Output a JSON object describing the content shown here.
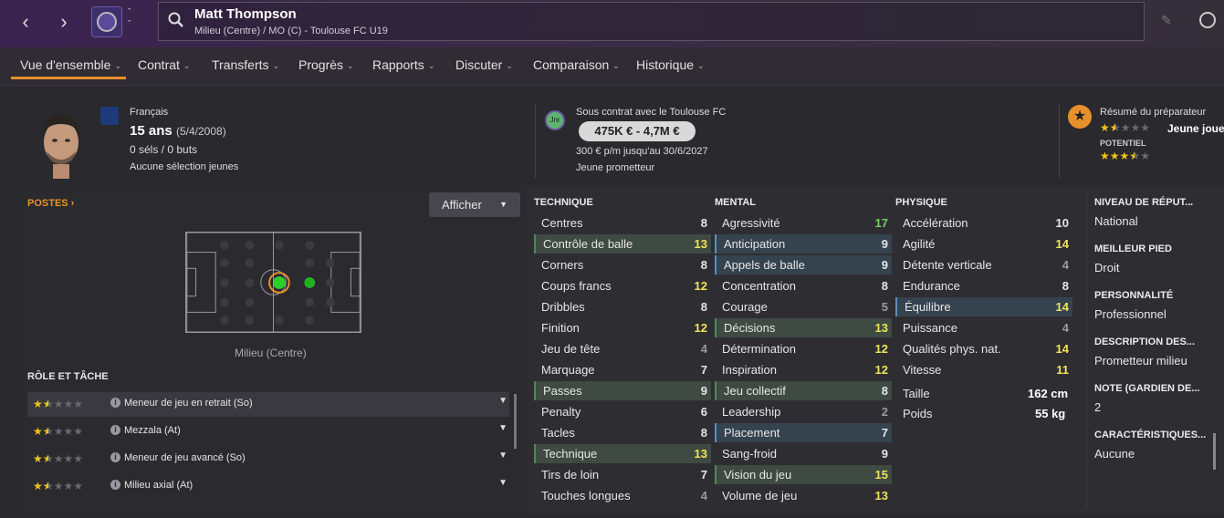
{
  "header": {
    "player_name": "Matt Thompson",
    "player_sub": "Milieu (Centre) / MO (C) - Toulouse FC U19"
  },
  "tabs": [
    {
      "label": "Vue d'ensemble"
    },
    {
      "label": "Contrat"
    },
    {
      "label": "Transferts"
    },
    {
      "label": "Progrès"
    },
    {
      "label": "Rapports"
    },
    {
      "label": "Discuter"
    },
    {
      "label": "Comparaison"
    },
    {
      "label": "Historique"
    }
  ],
  "profile": {
    "nationality": "Français",
    "age": "15 ans",
    "dob": "(5/4/2008)",
    "caps": "0 séls / 0 buts",
    "youth": "Aucune sélection jeunes"
  },
  "contract": {
    "badge": "Jnr",
    "club_line": "Sous contrat avec le Toulouse FC",
    "value_range": "475K € - 4,7M €",
    "wage_line": "300 € p/m jusqu'au 30/6/2027",
    "status": "Jeune prometteur"
  },
  "scout": {
    "title": "Résumé du préparateur",
    "current_stars": 1.5,
    "summary": "Jeune joue",
    "potential_label": "POTENTIEL",
    "potential_stars": 3.5
  },
  "positions": {
    "title": "POSTES",
    "show_button": "Afficher",
    "pitch_label": "Milieu (Centre)"
  },
  "roles": {
    "title": "RÔLE ET TÂCHE",
    "items": [
      {
        "label": "Meneur de jeu en retrait (So)",
        "stars": 1.5
      },
      {
        "label": "Mezzala (At)",
        "stars": 1.5
      },
      {
        "label": "Meneur de jeu avancé (So)",
        "stars": 1.5
      },
      {
        "label": "Milieu axial (At)",
        "stars": 1.5
      }
    ]
  },
  "technique": {
    "title": "TECHNIQUE",
    "attrs": [
      {
        "name": "Centres",
        "value": "8",
        "hl": ""
      },
      {
        "name": "Contrôle de balle",
        "value": "13",
        "hl": "g"
      },
      {
        "name": "Corners",
        "value": "8",
        "hl": ""
      },
      {
        "name": "Coups francs",
        "value": "12",
        "hl": ""
      },
      {
        "name": "Dribbles",
        "value": "8",
        "hl": ""
      },
      {
        "name": "Finition",
        "value": "12",
        "hl": ""
      },
      {
        "name": "Jeu de tête",
        "value": "4",
        "hl": ""
      },
      {
        "name": "Marquage",
        "value": "7",
        "hl": ""
      },
      {
        "name": "Passes",
        "value": "9",
        "hl": "g"
      },
      {
        "name": "Penalty",
        "value": "6",
        "hl": ""
      },
      {
        "name": "Tacles",
        "value": "8",
        "hl": ""
      },
      {
        "name": "Technique",
        "value": "13",
        "hl": "g"
      },
      {
        "name": "Tirs de loin",
        "value": "7",
        "hl": ""
      },
      {
        "name": "Touches longues",
        "value": "4",
        "hl": ""
      }
    ]
  },
  "mental": {
    "title": "MENTAL",
    "attrs": [
      {
        "name": "Agressivité",
        "value": "17",
        "hl": ""
      },
      {
        "name": "Anticipation",
        "value": "9",
        "hl": "b"
      },
      {
        "name": "Appels de balle",
        "value": "9",
        "hl": "b"
      },
      {
        "name": "Concentration",
        "value": "8",
        "hl": ""
      },
      {
        "name": "Courage",
        "value": "5",
        "hl": ""
      },
      {
        "name": "Décisions",
        "value": "13",
        "hl": "g"
      },
      {
        "name": "Détermination",
        "value": "12",
        "hl": ""
      },
      {
        "name": "Inspiration",
        "value": "12",
        "hl": ""
      },
      {
        "name": "Jeu collectif",
        "value": "8",
        "hl": "g"
      },
      {
        "name": "Leadership",
        "value": "2",
        "hl": ""
      },
      {
        "name": "Placement",
        "value": "7",
        "hl": "b"
      },
      {
        "name": "Sang-froid",
        "value": "9",
        "hl": ""
      },
      {
        "name": "Vision du jeu",
        "value": "15",
        "hl": "g"
      },
      {
        "name": "Volume de jeu",
        "value": "13",
        "hl": ""
      }
    ]
  },
  "physique": {
    "title": "PHYSIQUE",
    "attrs": [
      {
        "name": "Accélération",
        "value": "10",
        "hl": ""
      },
      {
        "name": "Agilité",
        "value": "14",
        "hl": ""
      },
      {
        "name": "Détente verticale",
        "value": "4",
        "hl": ""
      },
      {
        "name": "Endurance",
        "value": "8",
        "hl": ""
      },
      {
        "name": "Équilibre",
        "value": "14",
        "hl": "b"
      },
      {
        "name": "Puissance",
        "value": "4",
        "hl": ""
      },
      {
        "name": "Qualités phys. nat.",
        "value": "14",
        "hl": ""
      },
      {
        "name": "Vitesse",
        "value": "11",
        "hl": ""
      }
    ],
    "height_label": "Taille",
    "height": "162 cm",
    "weight_label": "Poids",
    "weight": "55 kg"
  },
  "info": [
    {
      "head": "NIVEAU DE RÉPUT...",
      "value": "National"
    },
    {
      "head": "MEILLEUR PIED",
      "value": "Droit"
    },
    {
      "head": "PERSONNALITÉ",
      "value": "Professionnel"
    },
    {
      "head": "DESCRIPTION DES...",
      "value": "Prometteur milieu"
    },
    {
      "head": "NOTE (GARDIEN DE...",
      "value": "2"
    },
    {
      "head": "CARACTÉRISTIQUES...",
      "value": "Aucune"
    }
  ],
  "colors": {
    "accent": "#e8902c",
    "green": "#6ed35a",
    "yellow": "#f0e35a"
  }
}
